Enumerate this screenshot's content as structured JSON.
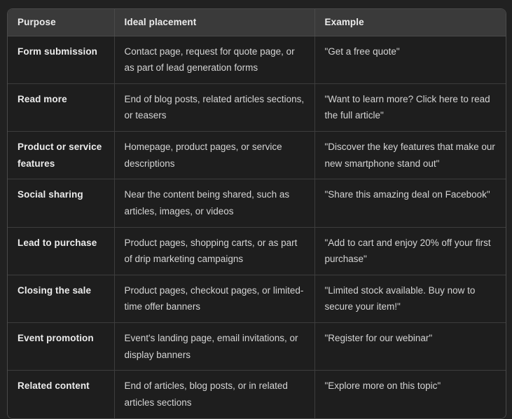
{
  "table": {
    "columns": [
      {
        "key": "purpose",
        "label": "Purpose"
      },
      {
        "key": "placement",
        "label": "Ideal placement"
      },
      {
        "key": "example",
        "label": "Example"
      }
    ],
    "rows": [
      {
        "purpose": "Form submission",
        "placement": "Contact page, request for quote page, or as part of lead generation forms",
        "example": "\"Get a free quote\""
      },
      {
        "purpose": "Read more",
        "placement": "End of blog posts, related articles sections, or teasers",
        "example": "\"Want to learn more? Click here to read the full article\""
      },
      {
        "purpose": "Product or service features",
        "placement": "Homepage, product pages, or service descriptions",
        "example": "\"Discover the key features that make our new smartphone stand out\""
      },
      {
        "purpose": "Social sharing",
        "placement": "Near the content being shared, such as articles, images, or videos",
        "example": "\"Share this amazing deal on Facebook\""
      },
      {
        "purpose": "Lead to purchase",
        "placement": "Product pages, shopping carts, or as part of drip marketing campaigns",
        "example": "\"Add to cart and enjoy 20% off your first purchase\""
      },
      {
        "purpose": "Closing the sale",
        "placement": "Product pages, checkout pages, or limited-time offer banners",
        "example": "\"Limited stock available. Buy now to secure your item!\""
      },
      {
        "purpose": "Event promotion",
        "placement": "Event's landing page, email invitations, or display banners",
        "example": "\"Register for our webinar\""
      },
      {
        "purpose": "Related content",
        "placement": "End of articles, blog posts, or in related articles sections",
        "example": "\"Explore more on this topic\""
      }
    ]
  },
  "colors": {
    "page_background": "#212121",
    "table_background": "#1e1e1e",
    "header_background": "#3a3a3a",
    "border": "#4a4a4a",
    "row_border": "#3d3d3d",
    "header_text": "#ececec",
    "body_text": "#d4d4d4"
  }
}
